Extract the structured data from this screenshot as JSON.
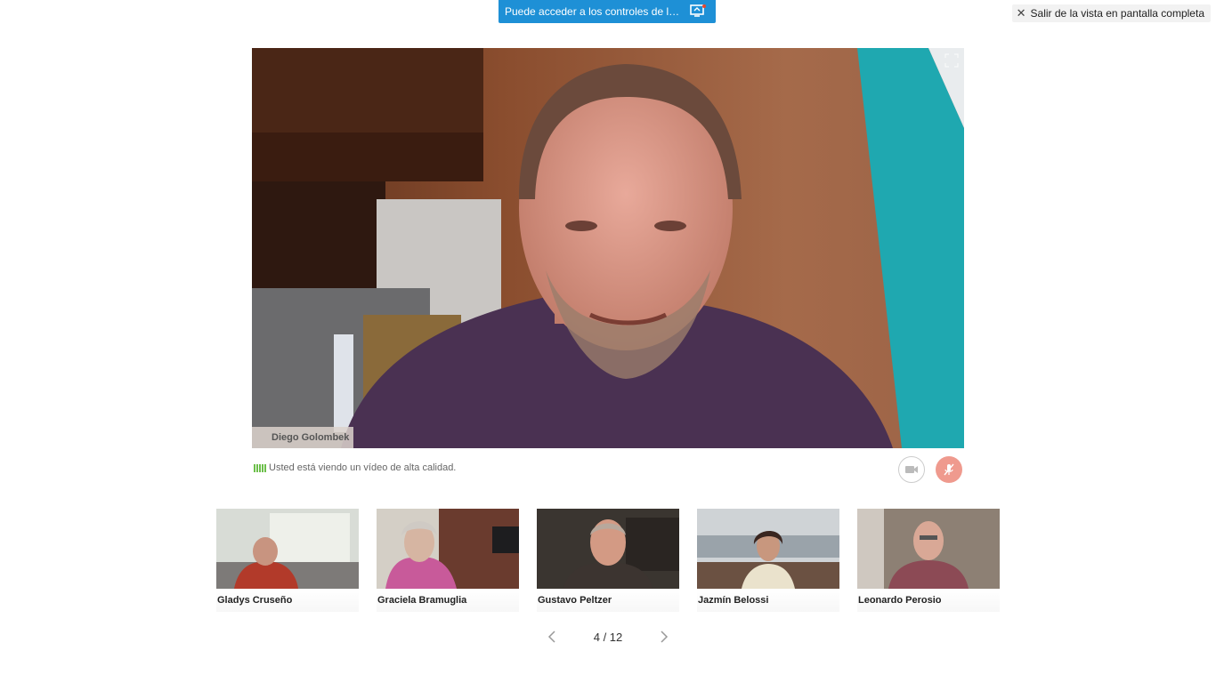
{
  "banner": {
    "text": "Puede acceder a los controles de la ses…",
    "icon": "screen-share-icon",
    "color": "#1e90d6"
  },
  "exit_fullscreen": {
    "label": "Salir de la vista en pantalla completa",
    "icon": "close-icon"
  },
  "main_video": {
    "participant": "Diego Golombek",
    "icon": "expand-icon"
  },
  "status": {
    "quality_text": "Usted está viendo un vídeo de alta calidad.",
    "icon": "signal-bars-icon"
  },
  "controls": {
    "camera_icon": "video-camera-icon",
    "mic_icon": "microphone-muted-icon",
    "mic_color": "#ef9a8e"
  },
  "participants": [
    {
      "name": "Gladys Cruseño"
    },
    {
      "name": "Graciela Bramuglia"
    },
    {
      "name": "Gustavo Peltzer"
    },
    {
      "name": "Jazmín Belossi"
    },
    {
      "name": "Leonardo Perosio"
    }
  ],
  "pager": {
    "current": "4",
    "separator": "/",
    "total": "12",
    "text": "4 / 12"
  }
}
